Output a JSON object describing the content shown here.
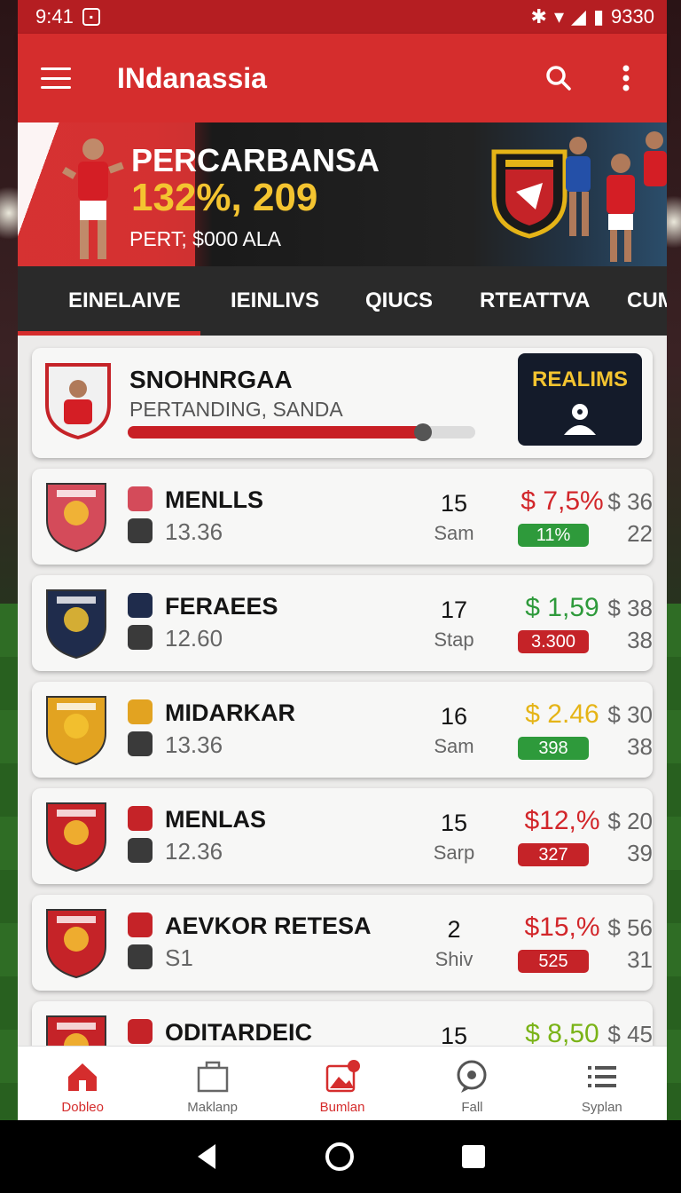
{
  "status": {
    "time": "9:41",
    "battery": "9330"
  },
  "app": {
    "title": "INdanassia"
  },
  "banner": {
    "title": "PERCARBANSA",
    "highlight": "132%, 209",
    "subtitle": "PERT; $000 ALA"
  },
  "tabs": [
    {
      "label": "EINELAIVE"
    },
    {
      "label": "IEINLIVS"
    },
    {
      "label": "QIUCS"
    },
    {
      "label": "RTEATTVA"
    },
    {
      "label": "CUM"
    }
  ],
  "featured": {
    "name": "SNOHNRGAA",
    "subtitle": "PERTANDING, SANDA",
    "progress": 0.85,
    "cta_label": "REALIMS"
  },
  "rows": [
    {
      "name": "MENLLS",
      "score": "13.36",
      "num": "15",
      "day": "Sam",
      "price": "$ 7,5%",
      "price_color": "#d2262a",
      "badge": "11%",
      "badge_color": "#2e9a3b",
      "alt": "$ 36",
      "alt2": "22",
      "crest_color": "#d44b5a"
    },
    {
      "name": "FERAEES",
      "score": "12.60",
      "num": "17",
      "day": "Stap",
      "price": "$ 1,59",
      "price_color": "#2e9a3b",
      "badge": "3.300",
      "badge_color": "#c52328",
      "alt": "$ 38",
      "alt2": "38",
      "crest_color": "#1f2c4c"
    },
    {
      "name": "MIDARKAR",
      "score": "13.36",
      "num": "16",
      "day": "Sam",
      "price": "$ 2.46",
      "price_color": "#e5b417",
      "badge": "398",
      "badge_color": "#2e9a3b",
      "alt": "$ 30",
      "alt2": "38",
      "crest_color": "#e2a321"
    },
    {
      "name": "MENLAS",
      "score": "12.36",
      "num": "15",
      "day": "Sarp",
      "price": "$12,%",
      "price_color": "#d2262a",
      "badge": "327",
      "badge_color": "#c52328",
      "alt": "$ 20",
      "alt2": "39",
      "crest_color": "#c52328"
    },
    {
      "name": "AEVKOR RETESA",
      "score": "S1",
      "num": "2",
      "day": "Shiv",
      "price": "$15,%",
      "price_color": "#d2262a",
      "badge": "525",
      "badge_color": "#c52328",
      "alt": "$ 56",
      "alt2": "31",
      "crest_color": "#c52328"
    },
    {
      "name": "ODITARDEIC",
      "score": "",
      "num": "15",
      "day": "",
      "price": "$ 8,50",
      "price_color": "#7ab317",
      "badge": "",
      "badge_color": "#2e9a3b",
      "alt": "$ 45",
      "alt2": "",
      "crest_color": "#c52328"
    }
  ],
  "bottom_nav": [
    {
      "label": "Dobleo",
      "icon": "home-icon"
    },
    {
      "label": "Maklanp",
      "icon": "bag-icon"
    },
    {
      "label": "Bumlan",
      "icon": "image-icon"
    },
    {
      "label": "Fall",
      "icon": "chat-icon"
    },
    {
      "label": "Syplan",
      "icon": "list-icon"
    }
  ]
}
